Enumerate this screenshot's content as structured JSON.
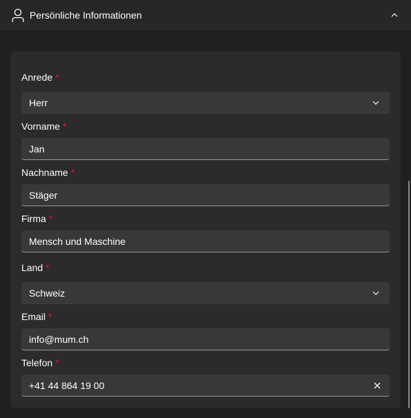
{
  "header": {
    "title": "Persönliche Informationen",
    "icon": "person-icon",
    "collapse_icon": "chevron-up-icon"
  },
  "required_marker": "*",
  "form": {
    "anrede": {
      "label": "Anrede",
      "value": "Herr"
    },
    "vorname": {
      "label": "Vorname",
      "value": "Jan"
    },
    "nachname": {
      "label": "Nachname",
      "value": "Stäger"
    },
    "firma": {
      "label": "Firma",
      "value": "Mensch und Maschine"
    },
    "land": {
      "label": "Land",
      "value": "Schweiz"
    },
    "email": {
      "label": "Email",
      "value": "info@mum.ch"
    },
    "telefon": {
      "label": "Telefon",
      "value": "+41 44 864 19 00"
    }
  },
  "colors": {
    "background": "#202020",
    "card": "#2b2b2b",
    "field": "#383838",
    "required": "#e81123"
  }
}
